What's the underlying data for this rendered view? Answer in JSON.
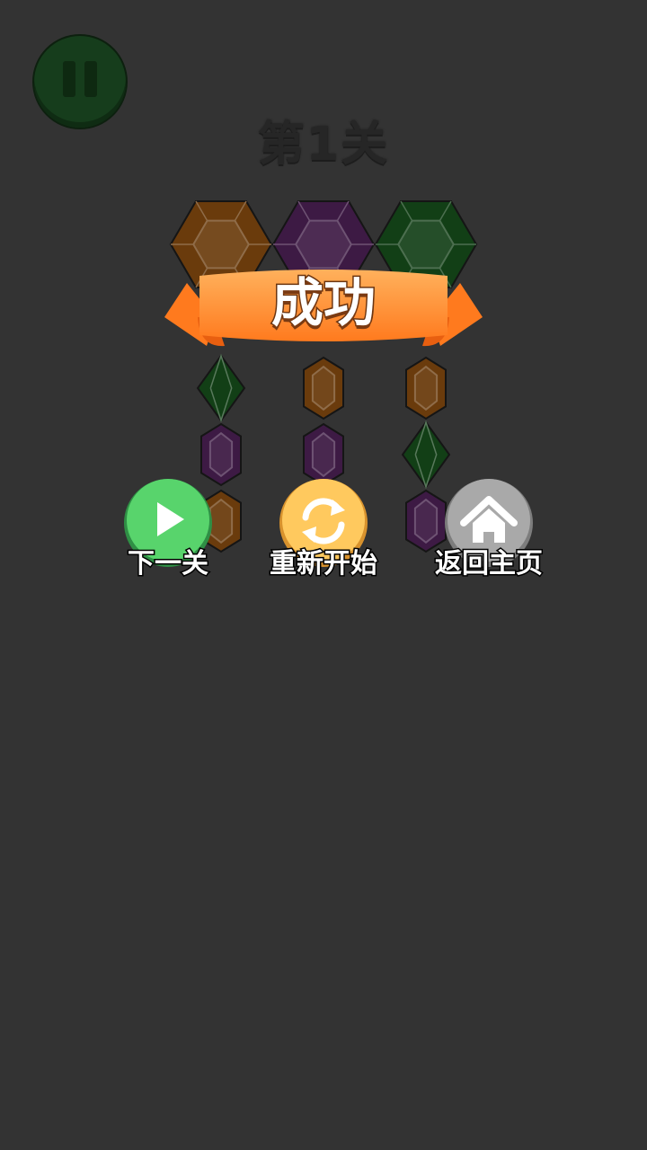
{
  "level": {
    "title": "第1关"
  },
  "banner": {
    "text": "成功"
  },
  "buttons": {
    "next": {
      "label": "下一关",
      "color": "#58d46c",
      "icon": "play-icon"
    },
    "restart": {
      "label": "重新开始",
      "color": "#ffc95e",
      "icon": "refresh-icon"
    },
    "home": {
      "label": "返回主页",
      "color": "#a9a9a9",
      "icon": "home-icon"
    }
  },
  "gem_colors": {
    "orange": "#6a3b0c",
    "purple": "#3d1a44",
    "green": "#123f16"
  },
  "tubes": [
    {
      "top": "orange",
      "stack": [
        "green",
        "purple",
        "orange"
      ]
    },
    {
      "top": "purple",
      "stack": [
        "orange",
        "purple"
      ]
    },
    {
      "top": "green",
      "stack": [
        "orange",
        "green",
        "purple"
      ]
    }
  ]
}
